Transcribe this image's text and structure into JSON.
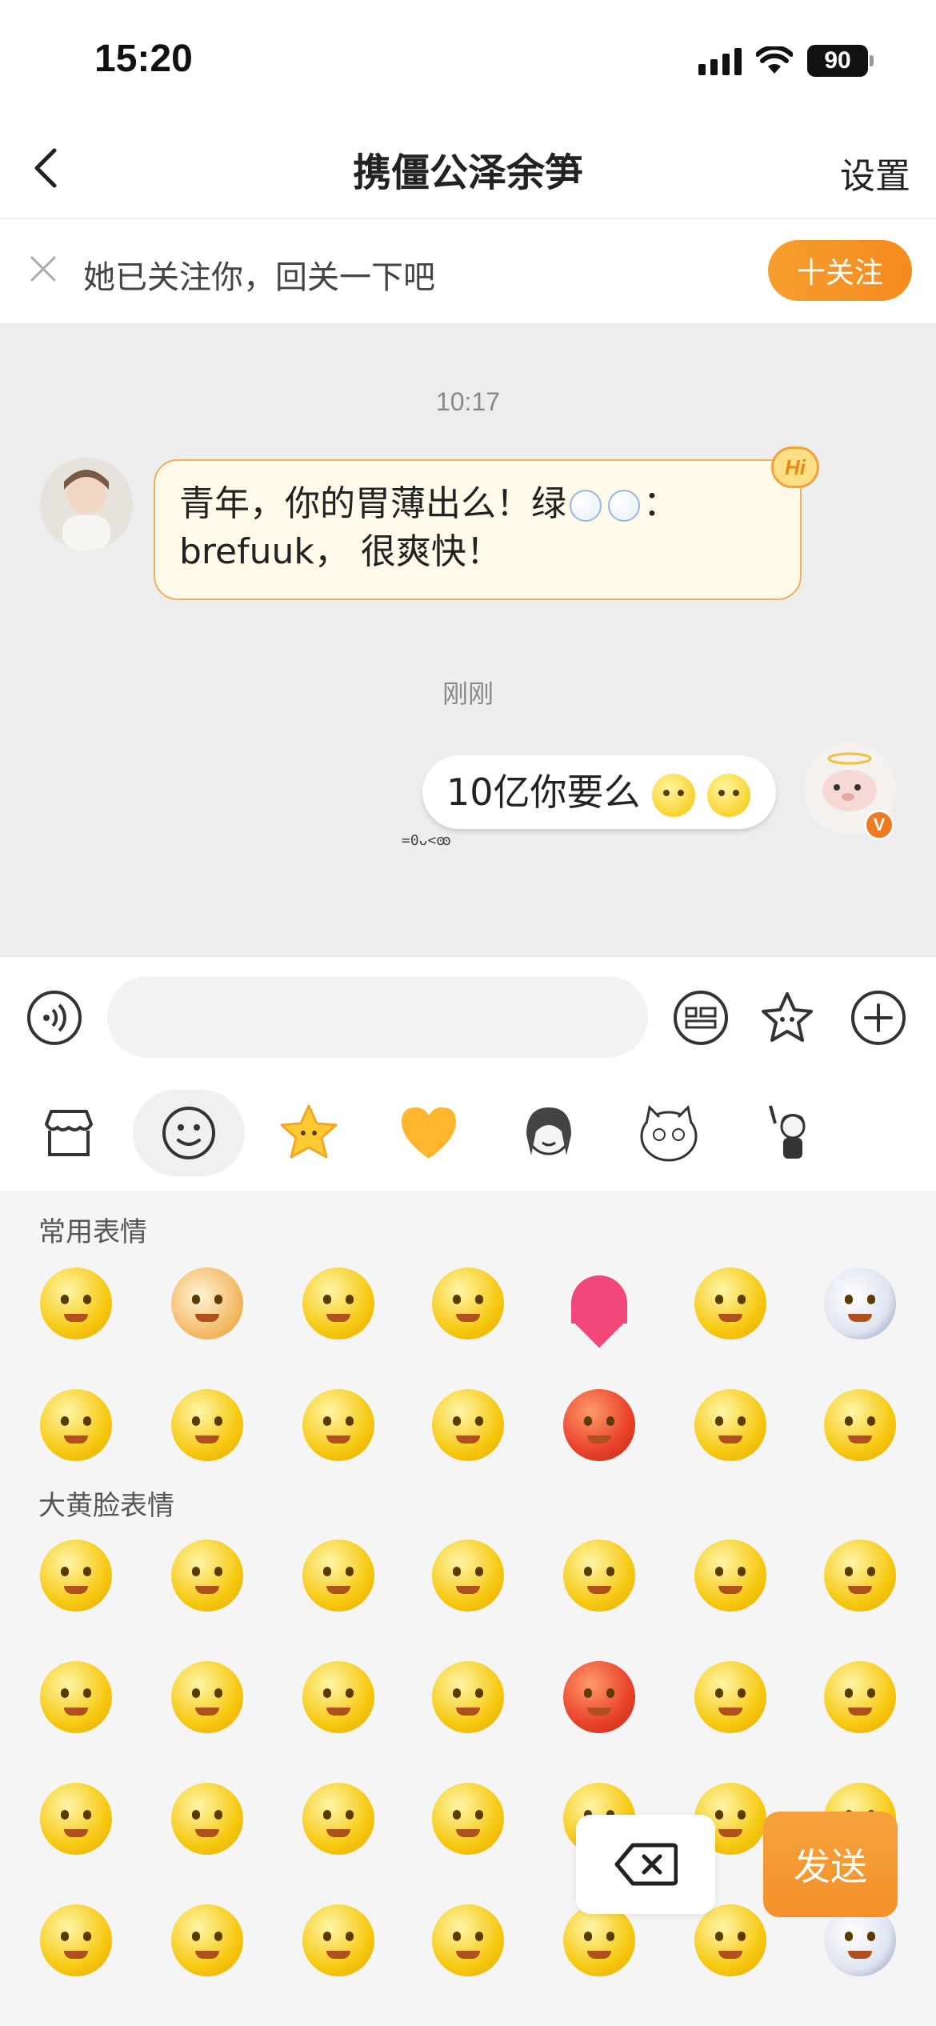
{
  "status_bar": {
    "time": "15:20",
    "battery": "90"
  },
  "nav": {
    "title": "携僵公泽余笋",
    "settings": "设置"
  },
  "follow_banner": {
    "text": "她已关注你，回关一下吧",
    "button": "十关注"
  },
  "chat": {
    "messages": [
      {
        "time": "10:17",
        "sender": "other",
        "text_line1": "青年，你的胃薄出么！绿",
        "text_line1_end": "：",
        "text_line2": "brefuuk， 很爽快！",
        "badge": "Hi"
      },
      {
        "time": "刚刚",
        "sender": "me",
        "text": "10亿你要么",
        "deco": "=0ᴗ<ꙭ",
        "vip_badge": "V"
      }
    ]
  },
  "input": {
    "placeholder": ""
  },
  "emoji_panel": {
    "tabs": [
      "store",
      "smiley",
      "star",
      "heart",
      "sticker-girl",
      "sticker-cat",
      "sticker-chibi"
    ],
    "sections": [
      {
        "title": "常用表情"
      },
      {
        "title": "大黄脸表情"
      }
    ]
  },
  "actions": {
    "send": "发送"
  },
  "colors": {
    "accent": "#f5921f",
    "chat_bg": "#ededed",
    "bubble_left_border": "#f0b060"
  }
}
